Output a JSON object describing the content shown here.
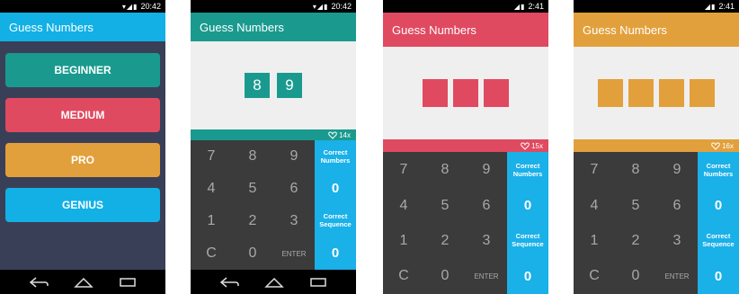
{
  "colors": {
    "teal": "#1a9a8f",
    "red": "#e04a60",
    "orange": "#e2a03c",
    "cyan": "#12b0e5",
    "blue_panel": "#1ab0e8",
    "dark_keypad": "#3b3b3b",
    "menu_bg": "#3a3f58"
  },
  "screens": [
    {
      "time": "20:42",
      "title": "Guess Numbers",
      "menu": [
        "BEGINNER",
        "MEDIUM",
        "PRO",
        "GENIUS"
      ]
    },
    {
      "time": "20:42",
      "title": "Guess Numbers",
      "digits": [
        "8",
        "9"
      ],
      "lives": "14x",
      "keys": [
        "7",
        "8",
        "9",
        "4",
        "5",
        "6",
        "1",
        "2",
        "3",
        "C",
        "0",
        "ENTER"
      ],
      "correct_numbers_label": "Correct Numbers",
      "correct_numbers_value": "0",
      "correct_sequence_label": "Correct Sequence",
      "correct_sequence_value": "0"
    },
    {
      "time": "2:41",
      "title": "Guess Numbers",
      "digits": [
        "",
        "",
        ""
      ],
      "lives": "15x",
      "keys": [
        "7",
        "8",
        "9",
        "4",
        "5",
        "6",
        "1",
        "2",
        "3",
        "C",
        "0",
        "ENTER"
      ],
      "correct_numbers_label": "Correct Numbers",
      "correct_numbers_value": "0",
      "correct_sequence_label": "Correct Sequence",
      "correct_sequence_value": "0"
    },
    {
      "time": "2:41",
      "title": "Guess Numbers",
      "digits": [
        "",
        "",
        "",
        ""
      ],
      "lives": "16x",
      "keys": [
        "7",
        "8",
        "9",
        "4",
        "5",
        "6",
        "1",
        "2",
        "3",
        "C",
        "0",
        "ENTER"
      ],
      "correct_numbers_label": "Correct Numbers",
      "correct_numbers_value": "0",
      "correct_sequence_label": "Correct Sequence",
      "correct_sequence_value": "0"
    }
  ],
  "icons": [
    "wifi-icon",
    "signal-icon",
    "battery-icon",
    "heart-icon",
    "back-icon",
    "home-icon",
    "recents-icon"
  ]
}
